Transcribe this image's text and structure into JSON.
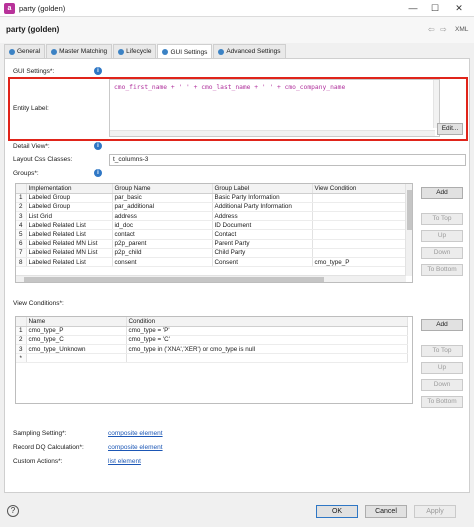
{
  "window": {
    "title": "party (golden)",
    "minimize": "—",
    "maximize": "☐",
    "close": "✕"
  },
  "header": {
    "title": "party (golden)",
    "back": "⇦",
    "forward": "⇨",
    "xml_label": "XML"
  },
  "tabs": [
    {
      "label": "General"
    },
    {
      "label": "Master Matching"
    },
    {
      "label": "Lifecycle"
    },
    {
      "label": "GUI Settings"
    },
    {
      "label": "Advanced Settings"
    }
  ],
  "gui_settings": {
    "section_label": "GUI Settings*:",
    "entity_label": "Entity Label:",
    "expression": "cmo_first_name + ' ' + cmo_last_name + ' ' + cmo_company_name",
    "edit_button": "Edit...",
    "detail_view_label": "Detail View*:",
    "layout_css_label": "Layout Css Classes:",
    "layout_css_value": "t_columns-3",
    "groups_label": "Groups*:"
  },
  "groups_table": {
    "columns": [
      "Implementation",
      "Group Name",
      "Group Label",
      "View Condition"
    ],
    "rows": [
      [
        "1",
        "Labeled Group",
        "par_basic",
        "Basic Party Information",
        ""
      ],
      [
        "2",
        "Labeled Group",
        "par_additional",
        "Additional Party Information",
        ""
      ],
      [
        "3",
        "List Grid",
        "address",
        "Address",
        ""
      ],
      [
        "4",
        "Labeled Related List",
        "id_doc",
        "ID Document",
        ""
      ],
      [
        "5",
        "Labeled Related List",
        "contact",
        "Contact",
        ""
      ],
      [
        "6",
        "Labeled Related MN List",
        "p2p_parent",
        "Parent Party",
        ""
      ],
      [
        "7",
        "Labeled Related MN List",
        "p2p_child",
        "Child Party",
        ""
      ],
      [
        "8",
        "Labeled Related List",
        "consent",
        "Consent",
        "cmo_type_P"
      ]
    ]
  },
  "side_buttons": {
    "add": "Add",
    "to_top": "To Top",
    "up": "Up",
    "down": "Down",
    "to_bottom": "To Bottom"
  },
  "view_conditions": {
    "label": "View Conditions*:",
    "columns": [
      "Name",
      "Condition"
    ],
    "rows": [
      [
        "1",
        "cmo_type_P",
        "cmo_type = 'P'"
      ],
      [
        "2",
        "cmo_type_C",
        "cmo_type = 'C'"
      ],
      [
        "3",
        "cmo_type_Unknown",
        "cmo_type in ('XNA','XER') or cmo_type is null"
      ],
      [
        "*",
        "",
        ""
      ]
    ]
  },
  "bottom": {
    "sampling_label": "Sampling Setting*:",
    "sampling_link": "composite element",
    "record_dq_label": "Record DQ Calculation*:",
    "record_dq_link": "composite element",
    "custom_actions_label": "Custom Actions*:",
    "custom_actions_link": "list element"
  },
  "footer": {
    "help": "?",
    "ok": "OK",
    "cancel": "Cancel",
    "apply": "Apply"
  },
  "colors": {
    "highlight": "#e0241a",
    "link": "#1b56b5",
    "expression": "#b0309c",
    "info": "#2f77c5"
  }
}
